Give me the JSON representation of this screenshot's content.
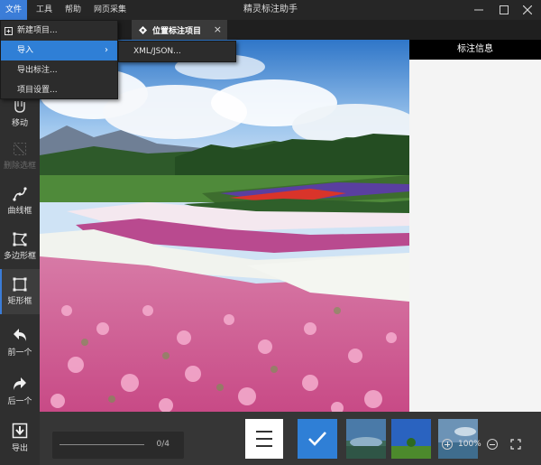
{
  "window": {
    "title": "精灵标注助手"
  },
  "menubar": {
    "file": "文件",
    "tools": "工具",
    "help": "帮助",
    "web": "网页采集"
  },
  "file_menu": {
    "items": [
      "新建项目...",
      "导入",
      "导出标注...",
      "项目设置..."
    ],
    "import_submenu": [
      "XML/JSON..."
    ]
  },
  "tab": {
    "label": "位置标注项目",
    "close": "×"
  },
  "toolbar": {
    "items": [
      {
        "label": "移动",
        "icon": "move-icon",
        "state": "normal"
      },
      {
        "label": "删除选框",
        "icon": "delete-box-icon",
        "state": "disabled"
      },
      {
        "label": "曲线框",
        "icon": "curve-box-icon",
        "state": "normal"
      },
      {
        "label": "多边形框",
        "icon": "polygon-box-icon",
        "state": "normal"
      },
      {
        "label": "矩形框",
        "icon": "rectangle-box-icon",
        "state": "active"
      },
      {
        "label": "前一个",
        "icon": "previous-icon",
        "state": "normal"
      },
      {
        "label": "后一个",
        "icon": "next-icon",
        "state": "normal"
      },
      {
        "label": "导出",
        "icon": "export-icon",
        "state": "normal"
      }
    ]
  },
  "panel": {
    "title": "标注信息"
  },
  "bottom": {
    "progress": {
      "count": "0/4",
      "value": 0
    },
    "zoom": "100%"
  },
  "colors": {
    "accent": "#2f7fd6",
    "menu_bg": "#2c2c2c",
    "panel_bg": "#f4f4f4"
  }
}
